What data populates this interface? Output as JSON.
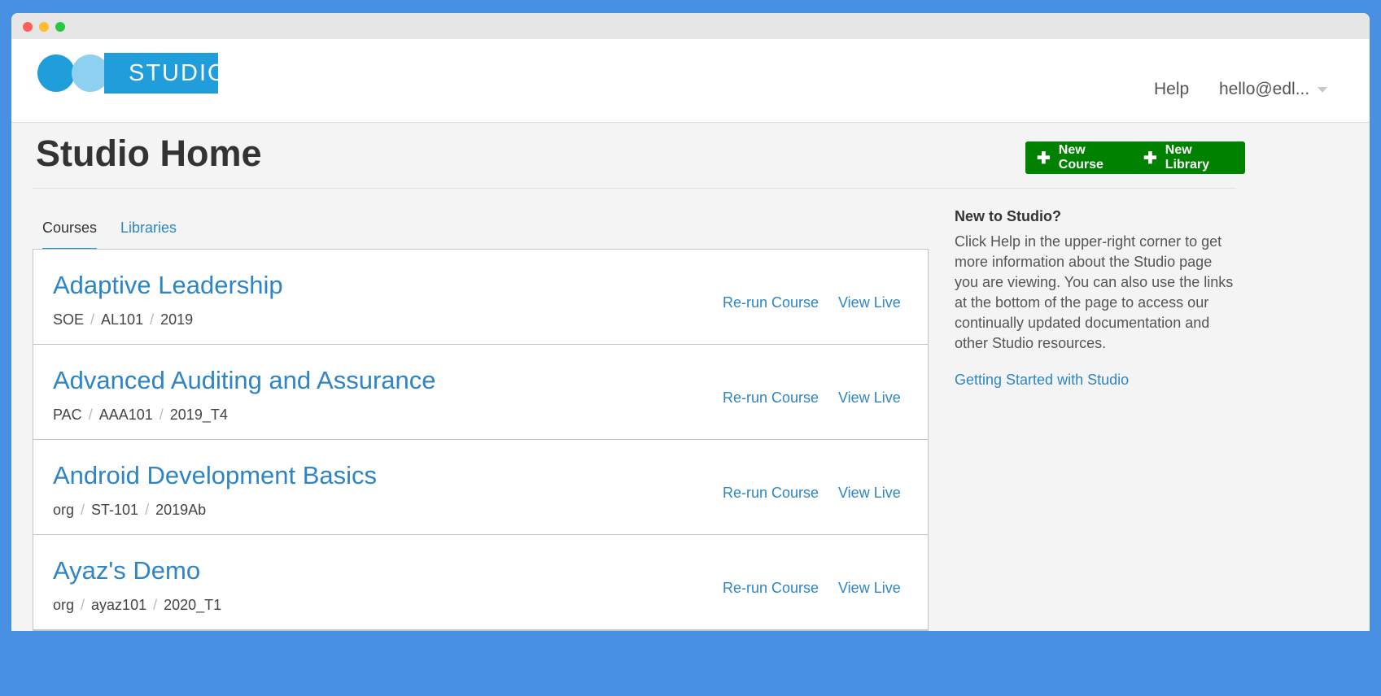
{
  "header": {
    "logo_text": "STUDIO",
    "help_label": "Help",
    "user_label": "hello@edl..."
  },
  "page": {
    "title": "Studio Home",
    "new_course_label": "New Course",
    "new_library_label": "New Library"
  },
  "tabs": [
    {
      "label": "Courses",
      "active": true
    },
    {
      "label": "Libraries",
      "active": false
    }
  ],
  "courses": [
    {
      "title": "Adaptive Leadership",
      "org": "SOE",
      "number": "AL101",
      "run": "2019",
      "rerun_label": "Re-run Course",
      "view_label": "View Live"
    },
    {
      "title": "Advanced Auditing and Assurance",
      "org": "PAC",
      "number": "AAA101",
      "run": "2019_T4",
      "rerun_label": "Re-run Course",
      "view_label": "View Live"
    },
    {
      "title": "Android Development Basics",
      "org": "org",
      "number": "ST-101",
      "run": "2019Ab",
      "rerun_label": "Re-run Course",
      "view_label": "View Live"
    },
    {
      "title": "Ayaz's Demo",
      "org": "org",
      "number": "ayaz101",
      "run": "2020_T1",
      "rerun_label": "Re-run Course",
      "view_label": "View Live"
    }
  ],
  "sidebar": {
    "heading": "New to Studio?",
    "body": "Click Help in the upper-right corner to get more information about the Studio page you are viewing. You can also use the links at the bottom of the page to access our continually updated documentation and other Studio resources.",
    "link_label": "Getting Started with Studio"
  },
  "colors": {
    "frame": "#4a90e2",
    "brand_blue": "#1f9edb",
    "link_blue": "#2d85c5",
    "button_green": "#008100"
  }
}
